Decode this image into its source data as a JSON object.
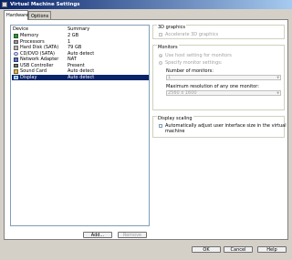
{
  "window": {
    "title": "Virtual Machine Settings"
  },
  "tabs": [
    {
      "label": "Hardware"
    },
    {
      "label": "Options"
    }
  ],
  "device_list": {
    "columns": {
      "device": "Device",
      "summary": "Summary"
    },
    "rows": [
      {
        "icon": "memory-icon",
        "name": "Memory",
        "summary": "2 GB",
        "selected": false
      },
      {
        "icon": "processor-icon",
        "name": "Processors",
        "summary": "1",
        "selected": false
      },
      {
        "icon": "hard-disk-icon",
        "name": "Hard Disk (SATA)",
        "summary": "79 GB",
        "selected": false
      },
      {
        "icon": "cd-dvd-icon",
        "name": "CD/DVD (SATA)",
        "summary": "Auto detect",
        "selected": false
      },
      {
        "icon": "network-adapter-icon",
        "name": "Network Adapter",
        "summary": "NAT",
        "selected": false
      },
      {
        "icon": "usb-controller-icon",
        "name": "USB Controller",
        "summary": "Present",
        "selected": false
      },
      {
        "icon": "sound-card-icon",
        "name": "Sound Card",
        "summary": "Auto detect",
        "selected": false
      },
      {
        "icon": "display-icon",
        "name": "Display",
        "summary": "Auto detect",
        "selected": true
      }
    ]
  },
  "device_buttons": {
    "add": "Add...",
    "remove": "Remove"
  },
  "graphics_3d": {
    "title": "3D graphics",
    "accelerate_label": "Accelerate 3D graphics"
  },
  "monitors": {
    "title": "Monitors",
    "use_host_label": "Use host setting for monitors",
    "specify_label": "Specify monitor settings:",
    "number_label": "Number of monitors:",
    "number_value": "1",
    "max_res_label": "Maximum resolution of any one monitor:",
    "max_res_value": "2560 x 1600"
  },
  "display_scaling": {
    "title": "Display scaling",
    "auto_adjust_label_line1": "Automatically adjust user interface size in the virtual",
    "auto_adjust_label_line2": "machine"
  },
  "footer_buttons": {
    "ok": "OK",
    "cancel": "Cancel",
    "help": "Help"
  },
  "colors": {
    "title_bar": "#0a246a",
    "selection": "#0a246a",
    "window_bg": "#d4d0c8"
  }
}
